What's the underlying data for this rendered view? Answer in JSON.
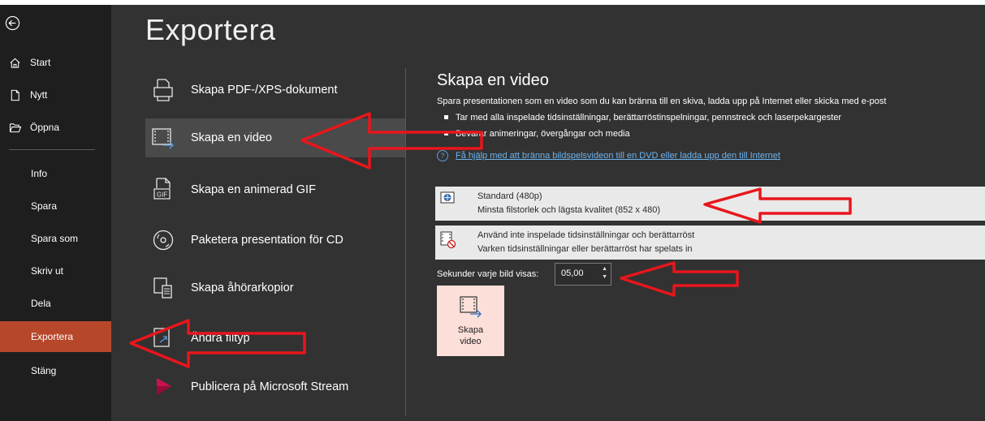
{
  "nav": {
    "items": [
      {
        "label": "Start",
        "icon": "home-icon"
      },
      {
        "label": "Nytt",
        "icon": "new-document-icon"
      },
      {
        "label": "Öppna",
        "icon": "open-folder-icon"
      },
      {
        "label": "Info"
      },
      {
        "label": "Spara"
      },
      {
        "label": "Spara som"
      },
      {
        "label": "Skriv ut"
      },
      {
        "label": "Dela"
      },
      {
        "label": "Exportera",
        "active": true
      },
      {
        "label": "Stäng"
      }
    ]
  },
  "page": {
    "title": "Exportera"
  },
  "options": [
    {
      "label": "Skapa PDF-/XPS-dokument",
      "icon": "pdf-document-icon"
    },
    {
      "label": "Skapa en video",
      "icon": "video-icon",
      "selected": true
    },
    {
      "label": "Skapa en animerad GIF",
      "icon": "gif-icon"
    },
    {
      "label": "Paketera presentation för CD",
      "icon": "cd-icon"
    },
    {
      "label": "Skapa åhörarkopior",
      "icon": "handouts-icon"
    },
    {
      "label": "Ändra filtyp",
      "icon": "change-file-type-icon"
    },
    {
      "label": "Publicera på Microsoft Stream",
      "icon": "stream-icon"
    }
  ],
  "panel": {
    "title": "Skapa en video",
    "description": "Spara presentationen som en video som du kan bränna till en skiva, ladda upp på Internet eller skicka med e-post",
    "bullets": [
      "Tar med alla inspelade tidsinställningar, berättarröstinspelningar, pennstreck och laserpekargester",
      "Bevarar animeringar, övergångar och media"
    ],
    "help_link": "Få hjälp med att bränna bildspelsvideon till en DVD eller ladda upp den till Internet",
    "quality": {
      "line1": "Standard (480p)",
      "line2": "Minsta filstorlek och lägsta kvalitet (852 x 480)"
    },
    "timings": {
      "line1": "Använd inte inspelade tidsinställningar och berättarröst",
      "line2": "Varken tidsinställningar eller berättarröst har spelats in"
    },
    "seconds_label": "Sekunder varje bild visas:",
    "seconds_value": "05,00",
    "create_button": "Skapa\nvideo"
  },
  "colors": {
    "accent": "#b7472a",
    "annotation": "#e8161c",
    "button_bg": "#fbdfd8"
  }
}
